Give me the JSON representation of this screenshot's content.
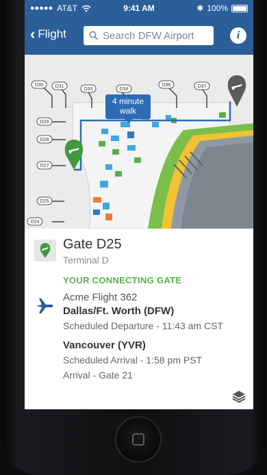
{
  "status": {
    "carrier": "AT&T",
    "time": "9:41 AM",
    "battery": "100%"
  },
  "nav": {
    "back_label": "Flight",
    "search_placeholder": "Search DFW Airport",
    "info_label": "i"
  },
  "map": {
    "walk_callout_line1": "4 minute",
    "walk_callout_line2": "walk",
    "gates": [
      "D30",
      "D31",
      "D33",
      "D34",
      "D36",
      "D37",
      "D29",
      "D28",
      "D27",
      "D25",
      "D24"
    ]
  },
  "details": {
    "gate_title": "Gate D25",
    "terminal": "Terminal D",
    "connecting_label": "YOUR CONNECTING GATE",
    "flight_name": "Acme Flight 362",
    "origin": "Dallas/Ft. Worth (DFW)",
    "departure": "Scheduled Departure - 11:43 am CST",
    "destination": "Vancouver (YVR)",
    "arrival": "Scheduled Arrival - 1:58 pm PST",
    "arrival_gate": "Arrival - Gate 21"
  },
  "colors": {
    "nav": "#2b5f9a",
    "route": "#2d6bb5",
    "accent_green": "#56b14a"
  }
}
